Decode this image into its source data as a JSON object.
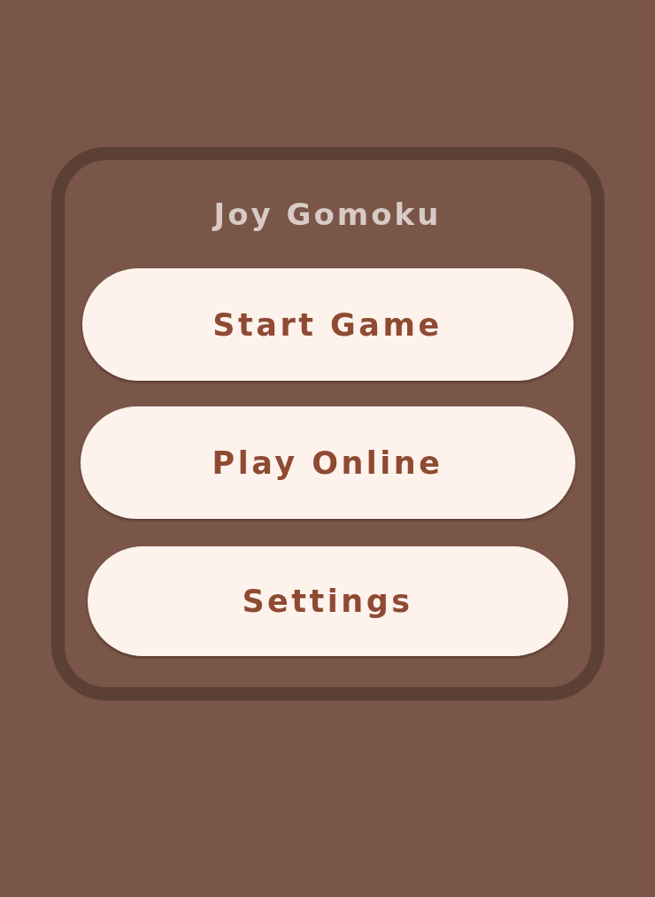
{
  "title": "Joy Gomoku",
  "buttons": [
    "Start Game",
    "Play Online",
    "Settings"
  ]
}
